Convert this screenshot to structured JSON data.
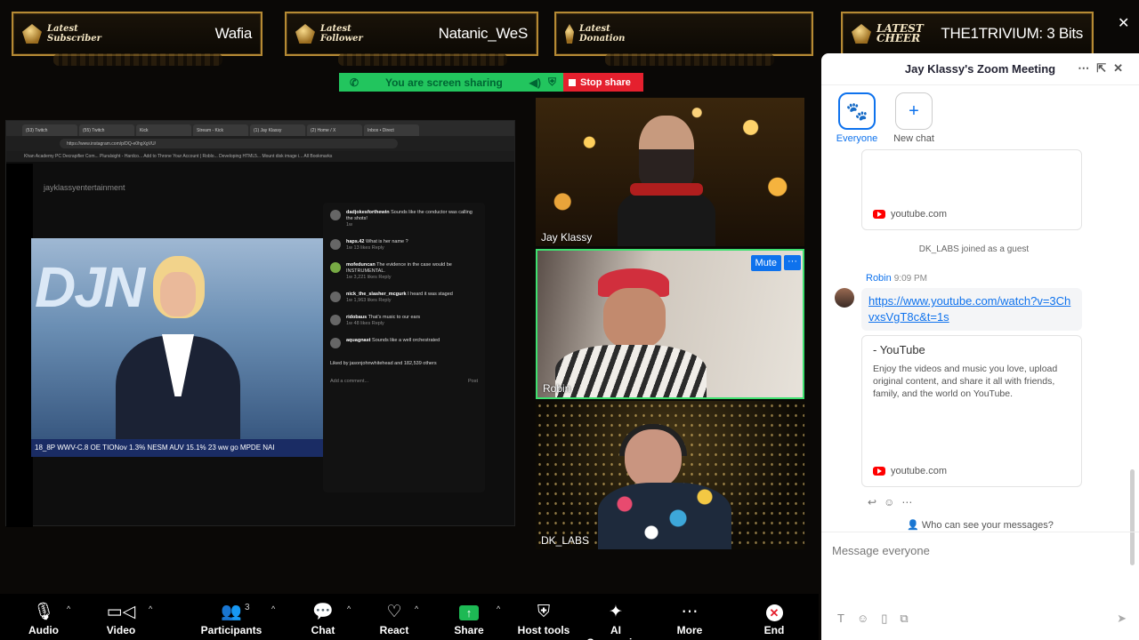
{
  "overlay": {
    "banners": [
      {
        "kind": "Latest Subscriber",
        "value": "Wafia"
      },
      {
        "kind": "Latest Follower",
        "value": "Natanic_WeS"
      },
      {
        "kind": "Latest Donation",
        "value": ""
      },
      {
        "kind": "LATEST CHEER",
        "value": "THE1TRIVIUM: 3 Bits"
      }
    ]
  },
  "sharebar": {
    "status": "You are screen sharing",
    "stop": "Stop share"
  },
  "shared": {
    "tabs": [
      "(53) Twitch",
      "(55) Twitch",
      "Kick",
      "Stream - Kick",
      "(1) Jay Klassy",
      "(2) Home / X",
      "Inbox • Direct"
    ],
    "url": "https://www.instagram.com/p/DQ-e0hgXgVU/",
    "bookmarks": "Khan Academy   PC Decrapifier Com...   Pluralsight - Hardco...   Add to Throne   Your Account | Roblo...   Developing HTML5...   Mount disk image i...   All Bookmarks",
    "ig_user": "jayklassyentertainment",
    "ticker": "18_8P WWV-C.8 OE TIONov 1.3% NESM AUV 15.1% 23 ww go MPDE NAI",
    "comments": [
      {
        "user": "dadjokesforthewin",
        "text": "Sounds like the conductor was calling the shots!",
        "meta": "1w"
      },
      {
        "user": "haps.42",
        "text": "What is her name ?",
        "meta": "1w   13 likes   Reply"
      },
      {
        "user": "mofeduncan",
        "text": "The evidence in the case would be INSTRUMENTAL.",
        "meta": "1w   3,221 likes   Reply"
      },
      {
        "user": "nick_the_slasher_mcgurk",
        "text": "I heard it was staged",
        "meta": "1w   1,963 likes   Reply"
      },
      {
        "user": "ridobaus",
        "text": "That's music to our ears",
        "meta": "1w   48 likes   Reply"
      },
      {
        "user": "aquagnast",
        "text": "Sounds like a well orchestrated",
        "meta": ""
      }
    ],
    "liked_by": "Liked by jasonjohnwhitehead and 182,539 others",
    "add_comment": "Add a comment...",
    "post": "Post"
  },
  "tiles": {
    "t1": {
      "name": "Jay Klassy"
    },
    "t2": {
      "name": "Robin",
      "mute": "Mute",
      "more": "···"
    },
    "t3": {
      "name": "DK_LABS"
    }
  },
  "toolbar": {
    "audio": "Audio",
    "video": "Video",
    "participants": "Participants",
    "participants_count": "3",
    "chat": "Chat",
    "react": "React",
    "share": "Share",
    "host_tools": "Host tools",
    "ai": "AI Companion",
    "more": "More",
    "end": "End"
  },
  "chat": {
    "title": "Jay Klassy's Zoom Meeting",
    "chips": [
      {
        "label": "Everyone"
      },
      {
        "label": "New chat"
      }
    ],
    "card1_domain": "youtube.com",
    "joined": "DK_LABS joined as a guest",
    "sender": "Robin",
    "time": "9:09 PM",
    "link": "https://www.youtube.com/watch?v=3ChvxsVgT8c&t=1s",
    "preview_title": "- YouTube",
    "preview_desc": "Enjoy the videos and music you love, upload original content, and share it all with friends, family, and the world on YouTube.",
    "card2_domain": "youtube.com",
    "who_can_see": "Who can see your messages?",
    "placeholder": "Message everyone"
  }
}
